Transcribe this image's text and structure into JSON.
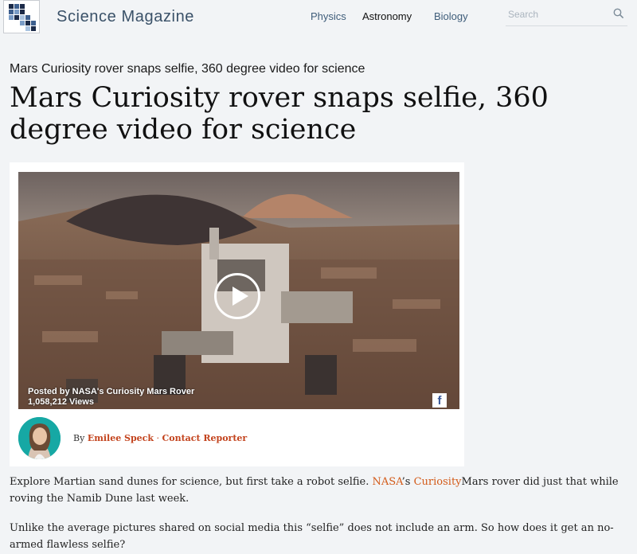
{
  "site": {
    "title": "Science Magazine"
  },
  "nav": {
    "items": [
      "Physics",
      "Astronomy",
      "Biology"
    ]
  },
  "search": {
    "placeholder": "Search"
  },
  "article": {
    "kicker": "Mars Curiosity rover snaps selfie, 360 degree video for science",
    "headline": "Mars Curiosity rover snaps selfie, 360 degree video for science",
    "video": {
      "posted_by": "Posted by NASA's Curiosity Mars Rover",
      "views": "1,058,212 Views",
      "facebook_glyph": "f"
    },
    "byline": {
      "prefix": "By",
      "author": "Emilee Speck",
      "separator": "·",
      "contact": "Contact Reporter"
    },
    "paragraphs": {
      "p1_a": "Explore Martian sand dunes for science, but first take a robot selfie. ",
      "p1_link1": "NASA",
      "p1_b": "’s ",
      "p1_link2": "Curiosity",
      "p1_c": "Mars rover did just that while roving the Namib Dune last week.",
      "p2": "Unlike the average pictures shared on social media this “selfie” does not include an arm. So how does it get an no-armed flawless selfie?"
    }
  },
  "colors": {
    "link": "#d35a18",
    "byline_link": "#c3431d",
    "nav": "#3f5d7a"
  }
}
